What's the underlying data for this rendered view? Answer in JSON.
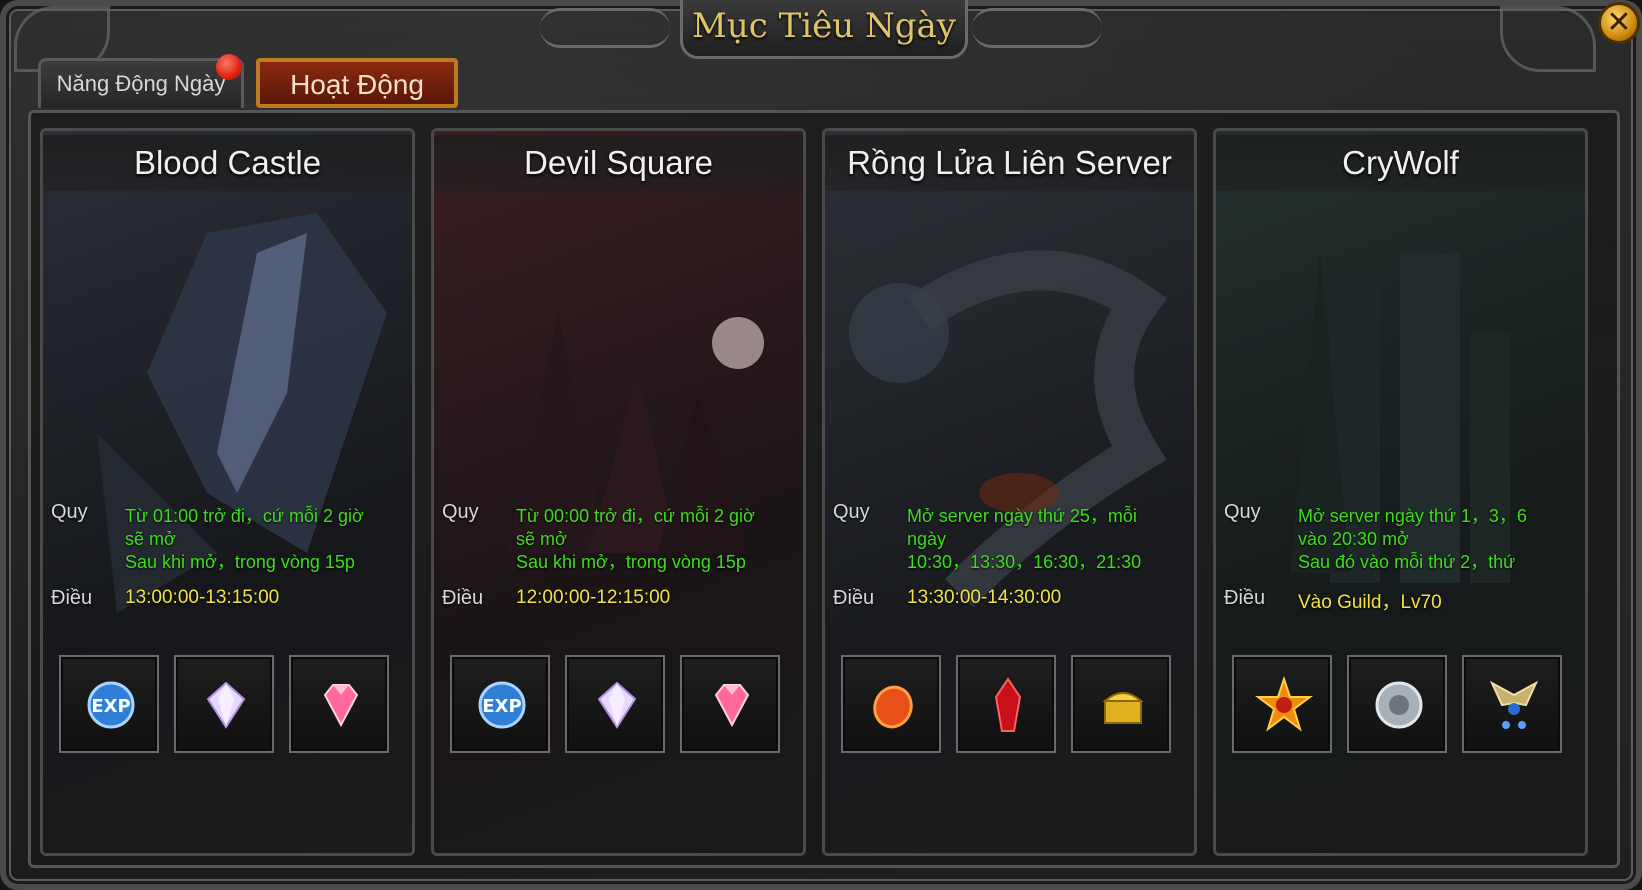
{
  "window": {
    "title": "Mục Tiêu Ngày",
    "close_icon": "close-icon"
  },
  "tabs": [
    {
      "label": "Năng Động Ngày",
      "active": false,
      "has_badge": true
    },
    {
      "label": "Hoạt Động",
      "active": true
    }
  ],
  "colors": {
    "rule_text": "#3fdc1e",
    "condition_text": "#f2e24a",
    "active_tab": "#8a2a10",
    "title_gold": "#e1c36a"
  },
  "cards": [
    {
      "name": "Blood Castle",
      "rule_label": "Quy",
      "rule_lines": [
        "Từ 01:00 trở đi，cứ mỗi 2 giờ",
        "sẽ mở",
        "Sau khi mở，trong vòng 15p"
      ],
      "condition_label": "Điều",
      "condition": "13:00:00-13:15:00",
      "rewards": [
        "exp-orb-icon",
        "white-gem-icon",
        "pink-gem-icon"
      ]
    },
    {
      "name": "Devil Square",
      "rule_label": "Quy",
      "rule_lines": [
        "Từ 00:00 trở đi，cứ mỗi 2 giờ",
        "sẽ mở",
        "Sau khi mở，trong vòng 15p"
      ],
      "condition_label": "Điều",
      "condition": "12:00:00-12:15:00",
      "rewards": [
        "exp-orb-icon",
        "white-gem-icon",
        "pink-gem-icon"
      ]
    },
    {
      "name": "Rồng Lửa Liên Server",
      "rule_label": "Quy",
      "rule_lines": [
        "Mở server ngày thứ 25，mỗi",
        "ngày",
        "10:30，13:30，16:30，21:30"
      ],
      "condition_label": "Điều",
      "condition": "13:30:00-14:30:00",
      "rewards": [
        "fire-orb-icon",
        "red-crystal-icon",
        "gold-chest-icon"
      ]
    },
    {
      "name": "CryWolf",
      "rule_label": "Quy",
      "rule_lines": [
        "Mở server ngày thứ 1，3，6",
        "vào 20:30 mở",
        "Sau đó vào mỗi thứ 2，thứ"
      ],
      "condition_label": "Điều",
      "condition": "Vào Guild，Lv70",
      "rewards": [
        "sun-medal-icon",
        "silver-medal-icon",
        "winged-emblem-icon"
      ]
    }
  ]
}
